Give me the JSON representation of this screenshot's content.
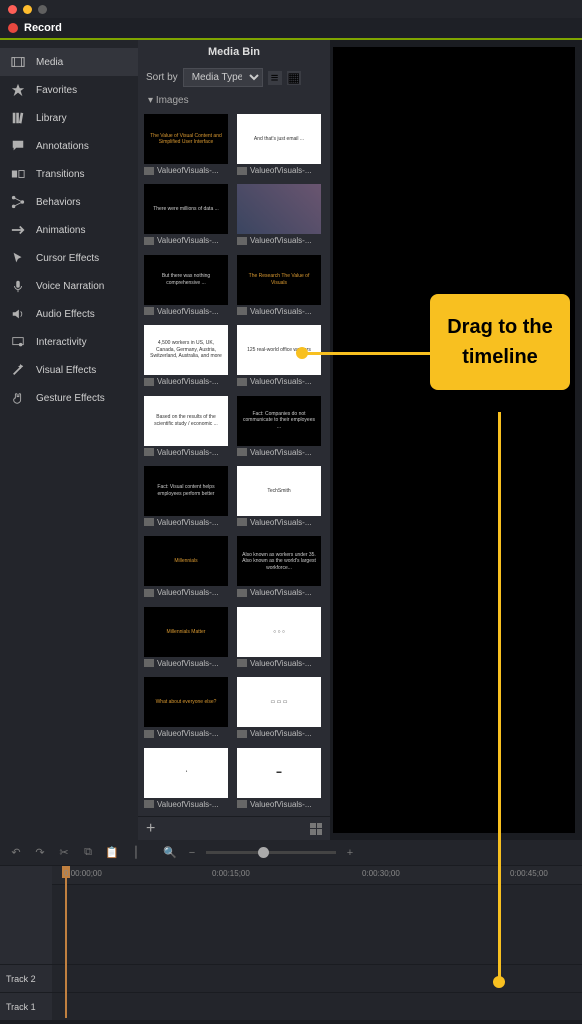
{
  "record_label": "Record",
  "sidebar": {
    "items": [
      {
        "label": "Media",
        "icon": "film"
      },
      {
        "label": "Favorites",
        "icon": "star"
      },
      {
        "label": "Library",
        "icon": "books"
      },
      {
        "label": "Annotations",
        "icon": "speech"
      },
      {
        "label": "Transitions",
        "icon": "squares"
      },
      {
        "label": "Behaviors",
        "icon": "nodes"
      },
      {
        "label": "Animations",
        "icon": "arrow"
      },
      {
        "label": "Cursor Effects",
        "icon": "cursor"
      },
      {
        "label": "Voice Narration",
        "icon": "mic"
      },
      {
        "label": "Audio Effects",
        "icon": "speaker"
      },
      {
        "label": "Interactivity",
        "icon": "interact"
      },
      {
        "label": "Visual Effects",
        "icon": "wand"
      },
      {
        "label": "Gesture Effects",
        "icon": "hand"
      }
    ]
  },
  "media_bin": {
    "title": "Media Bin",
    "sort_label": "Sort by",
    "sort_value": "Media Type",
    "section": "Images",
    "common_name": "ValueofVisuals-...",
    "thumbs": [
      {
        "bg": "black",
        "text": "The Value of Visual Content and Simplified User Interface",
        "cls": "orange-text"
      },
      {
        "bg": "white",
        "text": "And that's just email ..."
      },
      {
        "bg": "black",
        "text": "There were millions of data ..."
      },
      {
        "bg": "img",
        "text": ""
      },
      {
        "bg": "black",
        "text": "But there was nothing comprehensive ..."
      },
      {
        "bg": "black",
        "text": "The Research\\nThe Value of Visuals",
        "cls": "orange-text"
      },
      {
        "bg": "white",
        "text": "4,500 workers in US, UK, Canada, Germany, Austria, Switzerland, Australia, and more"
      },
      {
        "bg": "white",
        "text": "125 real-world office workers"
      },
      {
        "bg": "white",
        "text": "Based on the results of the scientific study / economic ..."
      },
      {
        "bg": "black",
        "text": "Fact: Companies do not communicate to their employees ..."
      },
      {
        "bg": "black",
        "text": "Fact: Visual content helps employees perform better"
      },
      {
        "bg": "white",
        "text": "TechSmith"
      },
      {
        "bg": "black",
        "text": "Millennials",
        "cls": "orange-text"
      },
      {
        "bg": "black",
        "text": "Also known as workers under 35. Also known as the world's largest workforce..."
      },
      {
        "bg": "black",
        "text": "Millennials Matter",
        "cls": "orange-text"
      },
      {
        "bg": "white",
        "text": "○ ○ ○"
      },
      {
        "bg": "black",
        "text": "What about everyone else?",
        "cls": "orange-text"
      },
      {
        "bg": "white",
        "text": "▭ ▭ ▭"
      },
      {
        "bg": "white",
        "text": "◔"
      },
      {
        "bg": "white",
        "text": "▬"
      }
    ]
  },
  "callout_text": "Drag to the timeline",
  "timeline": {
    "ticks": [
      "0:00:00;00",
      "0:00:15;00",
      "0:00:30;00",
      "0:00:45;00"
    ],
    "tracks": [
      "Track 2",
      "Track 1"
    ]
  }
}
